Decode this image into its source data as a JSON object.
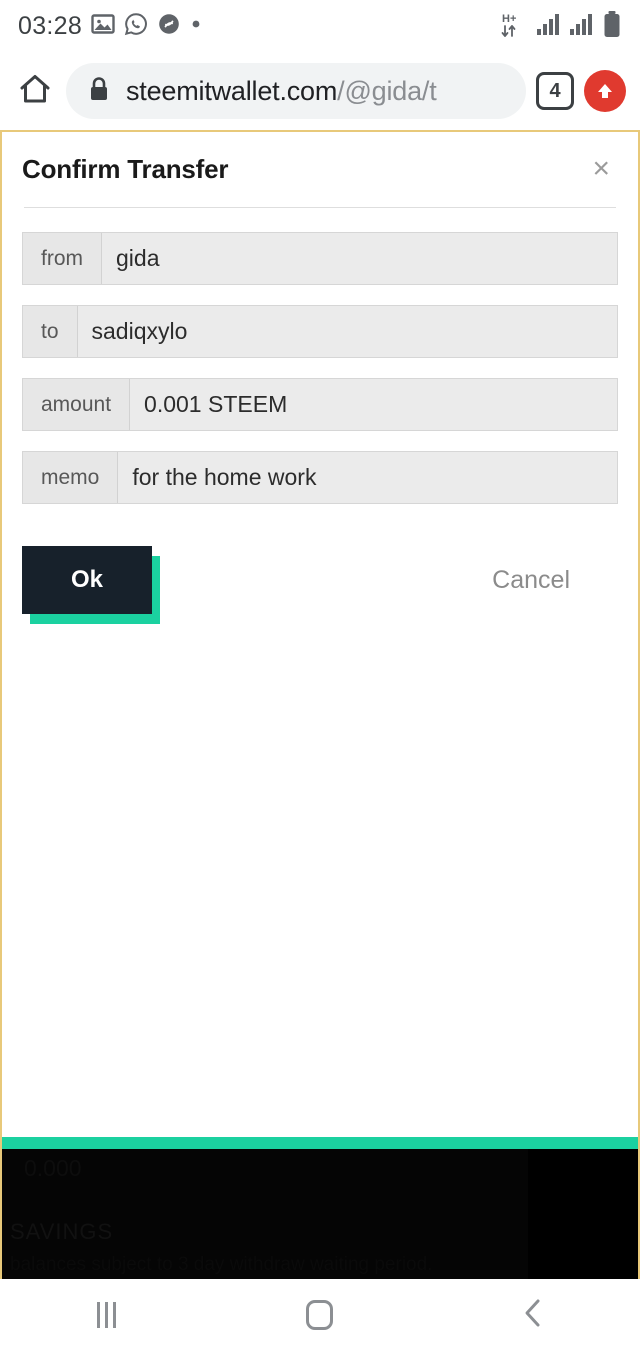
{
  "statusbar": {
    "clock": "03:28",
    "left_icons": [
      "gallery-icon",
      "whatsapp-icon",
      "shazam-icon",
      "dot-icon"
    ],
    "network_type": "H+",
    "right_icons": [
      "mobile-data-arrows-icon",
      "signal-bars-sim1-icon",
      "signal-bars-sim2-icon",
      "battery-icon"
    ]
  },
  "browser": {
    "home_icon": "home-icon",
    "lock_icon": "lock-icon",
    "url_domain": "steemitwallet.com",
    "url_path": "/@gida/t",
    "tab_count": "4",
    "action_icon": "upload-arrow-icon"
  },
  "dialog": {
    "title": "Confirm Transfer",
    "close_label": "×",
    "fields": [
      {
        "label": "from",
        "value": "gida"
      },
      {
        "label": "to",
        "value": "sadiqxylo"
      },
      {
        "label": "amount",
        "value": "0.001 STEEM"
      },
      {
        "label": "memo",
        "value": "for the home work"
      }
    ],
    "ok_label": "Ok",
    "cancel_label": "Cancel"
  },
  "background_page": {
    "amount_faint": "0.000",
    "section_title": "SAVINGS",
    "section_note": "balances subject to 3 day withdraw waiting period."
  },
  "navbar": {
    "recents_label": "recents-button",
    "home_label": "home-button",
    "back_label": "back-button"
  },
  "colors": {
    "accent_teal": "#1bd1a0",
    "button_dark": "#17212b",
    "browser_border": "#e8c97a",
    "action_red": "#e03a2f"
  }
}
